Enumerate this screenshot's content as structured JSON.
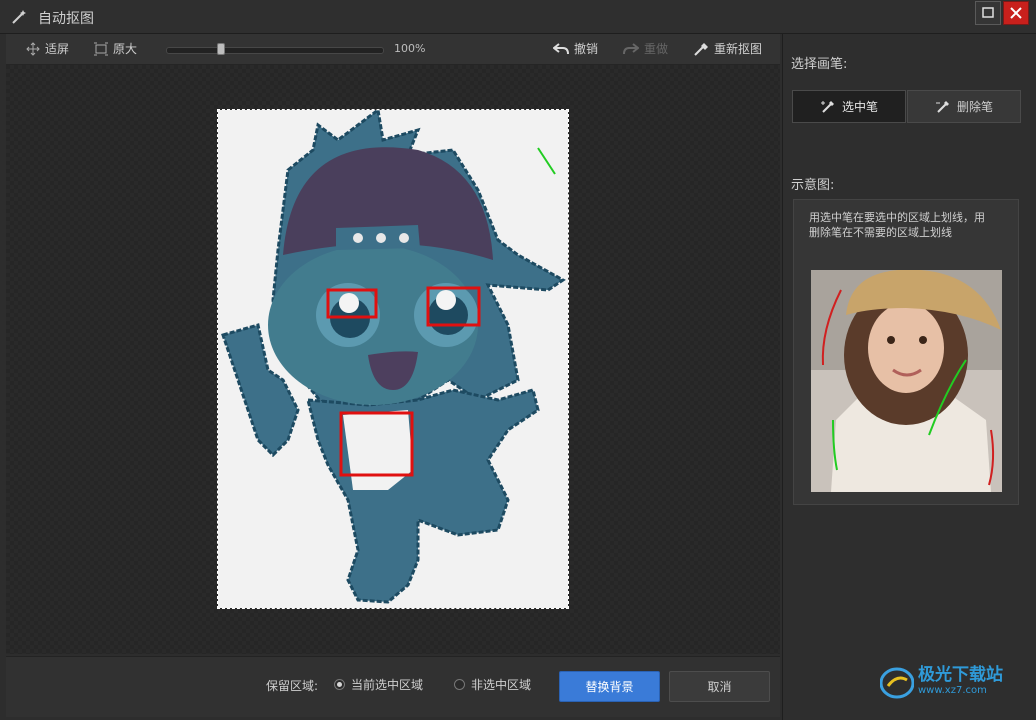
{
  "window": {
    "title": "自动抠图"
  },
  "toolbar": {
    "fit_label": "适屏",
    "original_label": "原大",
    "zoom_value": "100%",
    "zoom_fraction": 0.25,
    "undo_label": "撤销",
    "redo_label": "重做",
    "recrop_label": "重新抠图"
  },
  "bottom": {
    "keep_region_label": "保留区域:",
    "radio_current": "当前选中区域",
    "radio_non": "非选中区域",
    "selected": "current",
    "replace_button": "替换背景",
    "cancel_button": "取消"
  },
  "panel": {
    "choose_pen_label": "选择画笔:",
    "pen_select": "选中笔",
    "pen_delete": "删除笔",
    "diagram_label": "示意图:",
    "hint_line1": "用选中笔在要选中的区域上划线，用",
    "hint_line2": "删除笔在不需要的区域上划线"
  },
  "watermark": {
    "text": "极光下载站",
    "url": "www.xz7.com"
  },
  "colors": {
    "accent": "#3a7bd8",
    "close": "#c8201c",
    "mask_overlay": "#2e6a88",
    "highlight_box": "#e01010",
    "select_stroke": "#22cc22",
    "delete_stroke": "#d02020"
  }
}
